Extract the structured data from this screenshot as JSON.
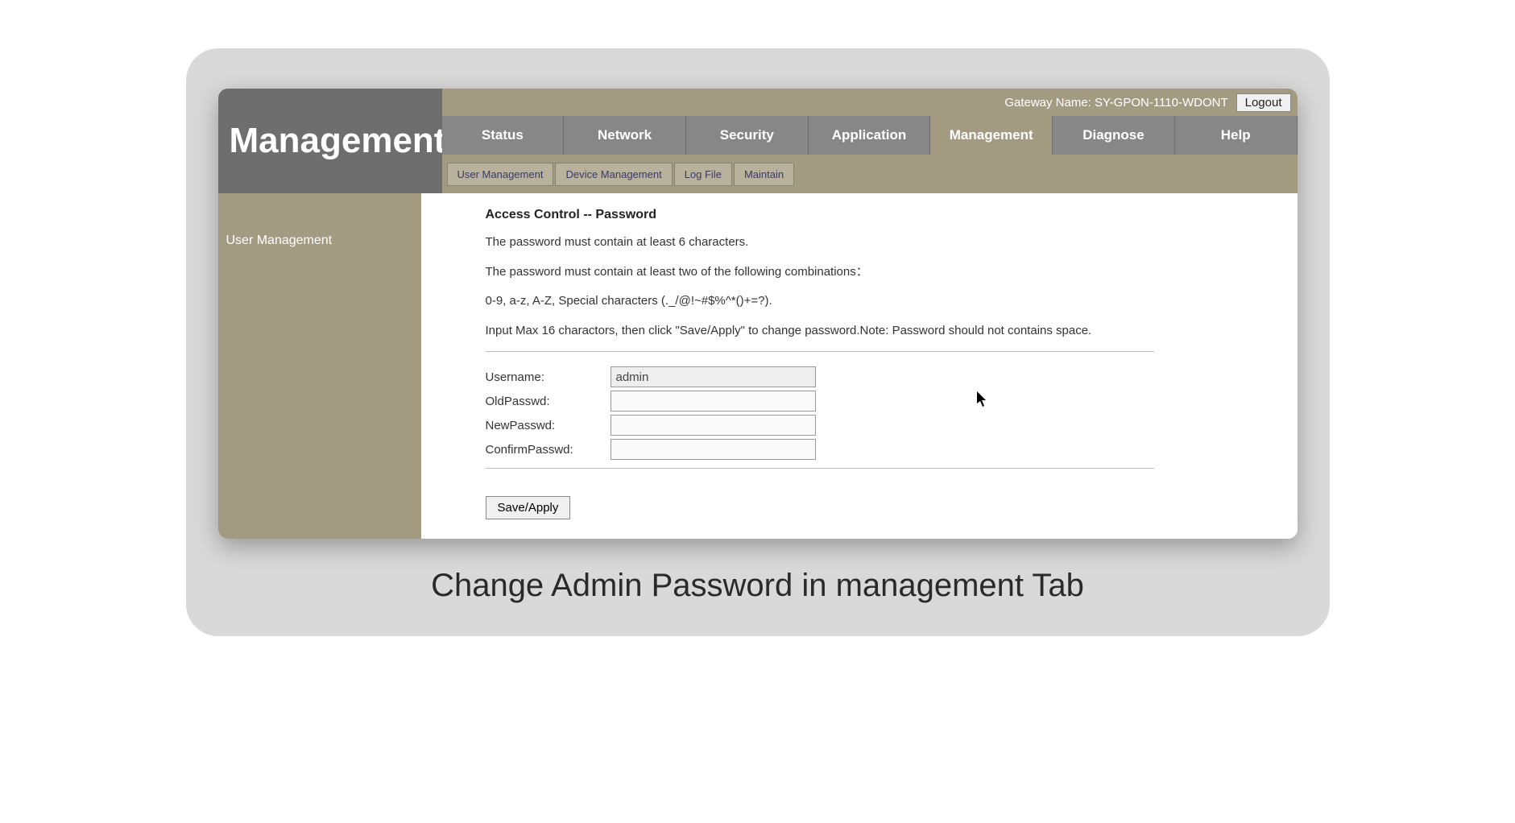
{
  "brand": "Management",
  "gateway_label": "Gateway Name: SY-GPON-1110-WDONT",
  "logout_label": "Logout",
  "main_tabs": {
    "status": "Status",
    "network": "Network",
    "security": "Security",
    "application": "Application",
    "management": "Management",
    "diagnose": "Diagnose",
    "help": "Help"
  },
  "sub_tabs": {
    "user_management": "User Management",
    "device_management": "Device Management",
    "log_file": "Log File",
    "maintain": "Maintain"
  },
  "sidebar": {
    "user_management": "User Management"
  },
  "content": {
    "title": "Access Control -- Password",
    "rule1": "The password must contain at least 6 characters.",
    "rule2": "The password must contain at least two of the following combinations：",
    "rule3": "0-9, a-z, A-Z, Special characters (._/@!~#$%^*()+=?).",
    "rule4": "Input Max 16 charactors, then click \"Save/Apply\" to change password.Note: Password should not contains space.",
    "labels": {
      "username": "Username:",
      "oldpasswd": "OldPasswd:",
      "newpasswd": "NewPasswd:",
      "confirmpasswd": "ConfirmPasswd:"
    },
    "values": {
      "username": "admin",
      "oldpasswd": "",
      "newpasswd": "",
      "confirmpasswd": ""
    },
    "save_label": "Save/Apply"
  },
  "caption": "Change Admin Password in management Tab"
}
